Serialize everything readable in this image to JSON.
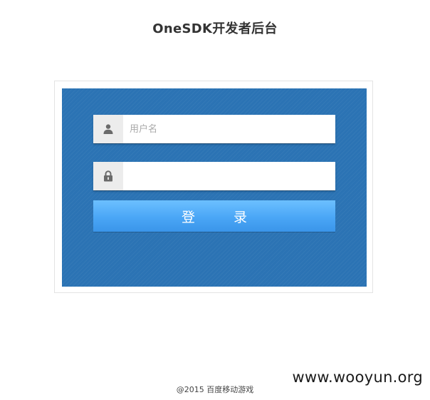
{
  "header": {
    "title": "OneSDK开发者后台"
  },
  "login_form": {
    "username": {
      "placeholder": "用户名",
      "value": "",
      "icon": "user-icon"
    },
    "password": {
      "placeholder": "",
      "value": "",
      "icon": "lock-icon"
    },
    "submit_label": "登 录"
  },
  "footer": {
    "copyright": "@2015 百度移动游戏"
  },
  "watermark": {
    "text": "www.wooyun.org"
  },
  "colors": {
    "card_background": "#2b73b4",
    "button_top": "#6cc0ff",
    "button_bottom": "#3a95ea",
    "icon_box": "#ececec",
    "icon": "#6a6a6a"
  }
}
